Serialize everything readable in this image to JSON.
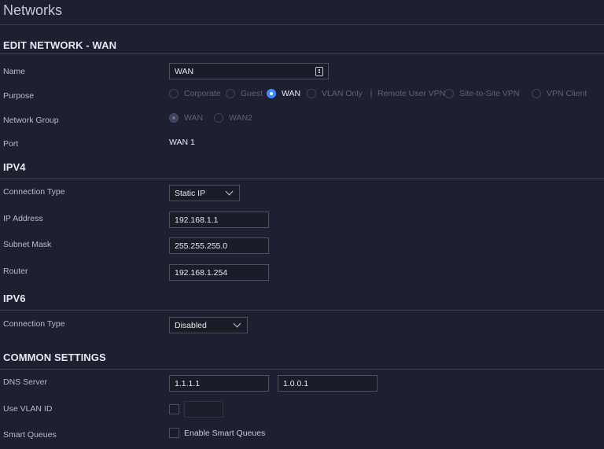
{
  "page_title": "Networks",
  "edit_section": {
    "title": "EDIT NETWORK - WAN",
    "name_label": "Name",
    "name_value": "WAN",
    "purpose_label": "Purpose",
    "purpose_options": [
      "Corporate",
      "Guest",
      "WAN",
      "VLAN Only",
      "Remote User VPN",
      "Site-to-Site VPN",
      "VPN Client"
    ],
    "purpose_selected": "WAN",
    "network_group_label": "Network Group",
    "network_group_options": [
      "WAN",
      "WAN2"
    ],
    "network_group_selected": "WAN",
    "port_label": "Port",
    "port_value": "WAN 1"
  },
  "ipv4": {
    "title": "IPV4",
    "connection_type_label": "Connection Type",
    "connection_type_value": "Static IP",
    "ip_address_label": "IP Address",
    "ip_address_value": "192.168.1.1",
    "subnet_mask_label": "Subnet Mask",
    "subnet_mask_value": "255.255.255.0",
    "router_label": "Router",
    "router_value": "192.168.1.254"
  },
  "ipv6": {
    "title": "IPV6",
    "connection_type_label": "Connection Type",
    "connection_type_value": "Disabled"
  },
  "common": {
    "title": "COMMON SETTINGS",
    "dns_label": "DNS Server",
    "dns_primary": "1.1.1.1",
    "dns_secondary": "1.0.0.1",
    "vlan_label": "Use VLAN ID",
    "vlan_value": "",
    "smart_queues_label": "Smart Queues",
    "smart_queues_checkbox_label": "Enable Smart Queues"
  },
  "colors": {
    "background": "#1d2030",
    "accent": "#3e8bff",
    "field_border": "#4a4f63"
  }
}
